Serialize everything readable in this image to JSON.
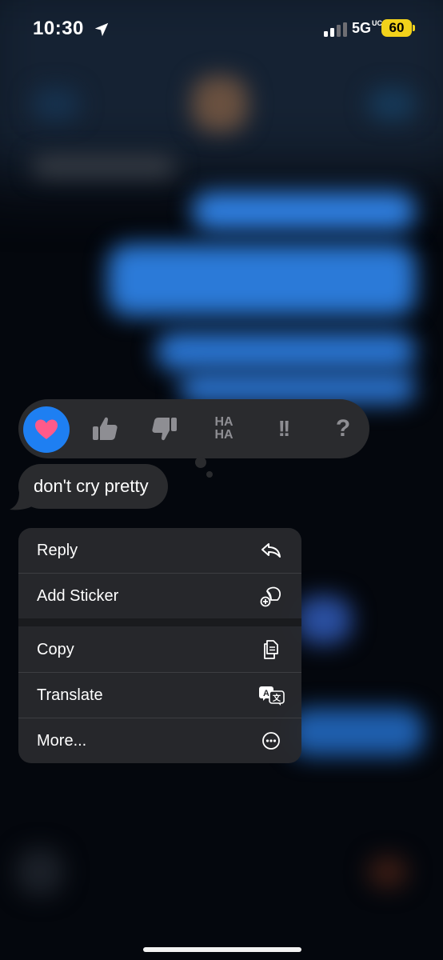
{
  "status_bar": {
    "time": "10:30",
    "network": "5G",
    "network_suffix": "UC",
    "battery": "60",
    "battery_color": "#f2d21b"
  },
  "tapback": {
    "items": [
      {
        "name": "heart",
        "selected": true,
        "label": ""
      },
      {
        "name": "thumbs-up",
        "selected": false,
        "label": ""
      },
      {
        "name": "thumbs-down",
        "selected": false,
        "label": ""
      },
      {
        "name": "haha",
        "selected": false,
        "label_top": "HA",
        "label_bottom": "HA"
      },
      {
        "name": "exclamation",
        "selected": false,
        "label": "!!"
      },
      {
        "name": "question",
        "selected": false,
        "label": "?"
      }
    ],
    "selected_color": "#1e7ff2",
    "heart_color": "#ff5a8a"
  },
  "message": {
    "text": "don't cry pretty"
  },
  "menu": {
    "items": [
      {
        "label": "Reply",
        "icon": "reply-icon"
      },
      {
        "label": "Add Sticker",
        "icon": "add-sticker-icon"
      },
      {
        "label": "Copy",
        "icon": "copy-icon"
      },
      {
        "label": "Translate",
        "icon": "translate-icon"
      },
      {
        "label": "More...",
        "icon": "more-icon"
      }
    ]
  }
}
